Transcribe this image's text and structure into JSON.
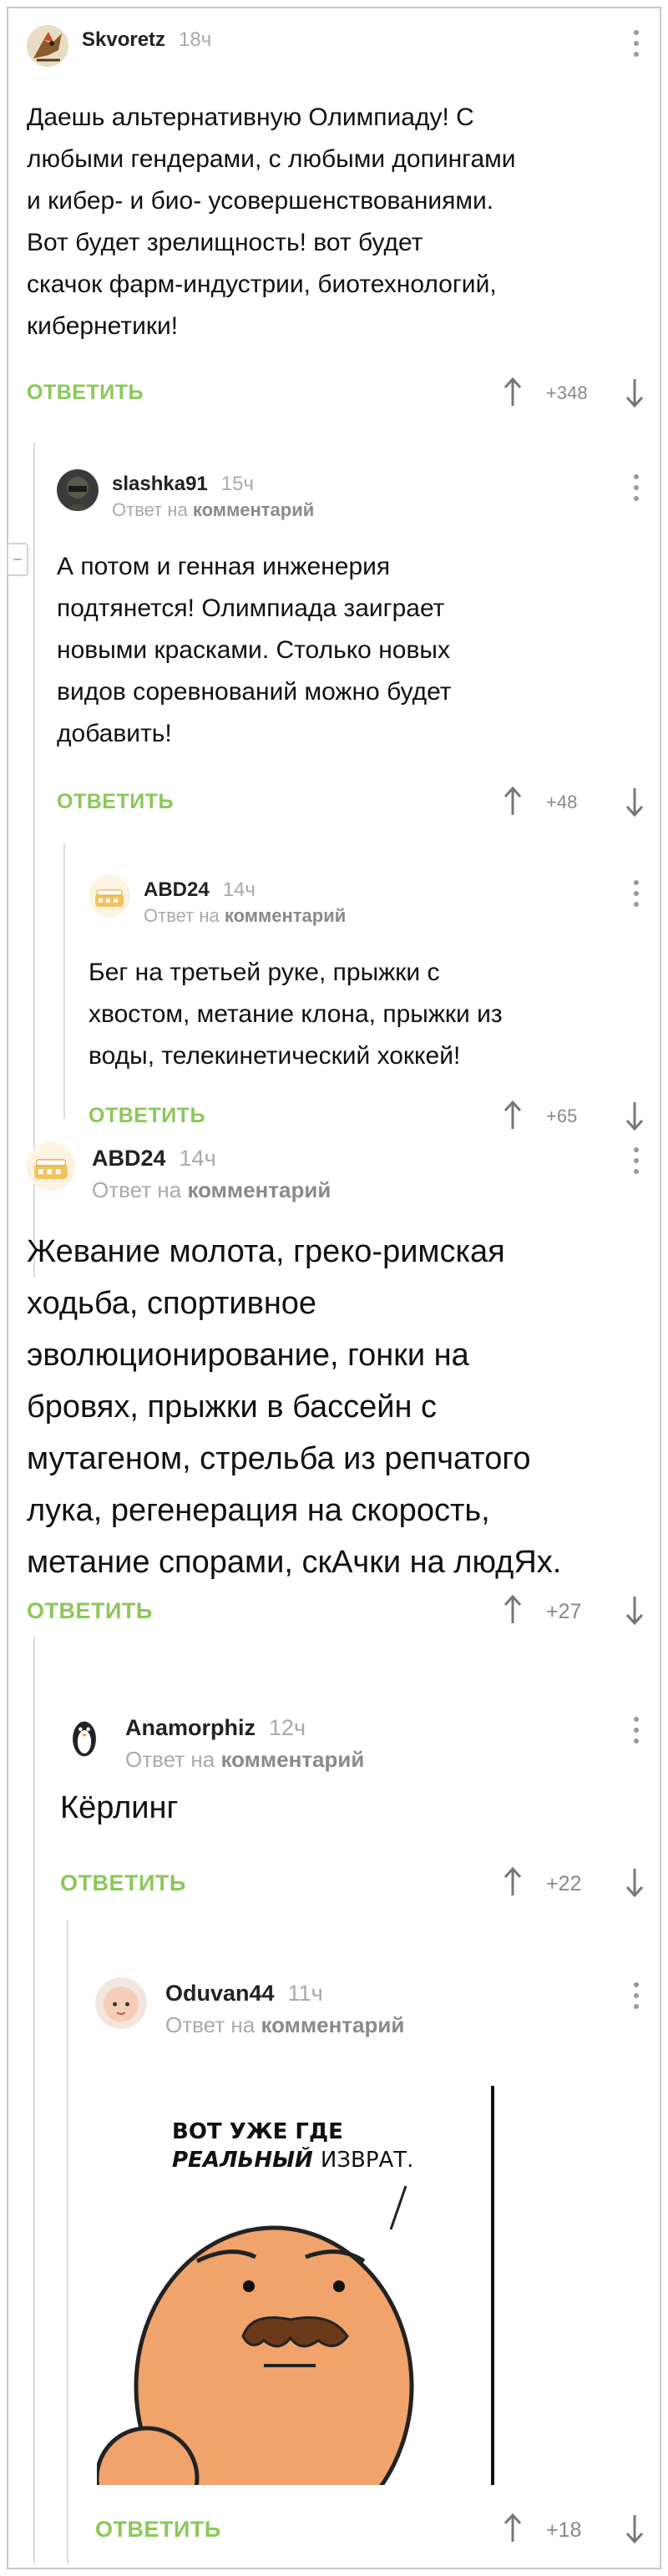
{
  "reply_label": "ОТВЕТИТЬ",
  "reply_to_prefix": "Ответ на",
  "reply_to_target": "комментарий",
  "colors": {
    "accent_green": "#8ac858",
    "muted_text": "#aaaaaa",
    "thread_line": "#dcdcdc"
  },
  "icons": {
    "upvote": "arrow-up-icon",
    "downvote": "arrow-down-icon",
    "menu": "more-vertical-icon"
  },
  "comments": [
    {
      "author": "Skvoretz",
      "time": "18ч",
      "text_lines": [
        "Даешь альтернативную Олимпиаду! С",
        "любыми гендерами, с любыми допингами",
        "и кибер- и био- усовершенствованиями.",
        "Вот будет зрелищность! вот будет",
        "скачок фарм-индустрии, биотехнологий,",
        "кибернетики!"
      ],
      "score": "+348"
    },
    {
      "author": "slashka91",
      "time": "15ч",
      "text_lines": [
        "А потом и генная инженерия",
        "подтянется! Олимпиада заиграет",
        "новыми красками. Столько новых",
        "видов соревнований можно будет",
        "добавить!"
      ],
      "score": "+48"
    },
    {
      "author": "ABD24",
      "time": "14ч",
      "text_lines": [
        "Бег на третьей руке, прыжки с",
        "хвостом, метание клона, прыжки из",
        "воды, телекинетический хоккей!"
      ],
      "score": "+65"
    },
    {
      "author": "ABD24",
      "time": "14ч",
      "text_lines": [
        "Жевание молота, греко-римская",
        "ходьба, спортивное",
        "эволюционирование, гонки на",
        "бровях, прыжки в бассейн с",
        "мутагеном, стрельба из репчатого",
        "лука, регенерация на скорость,",
        "метание спорами, скАчки на людЯх."
      ],
      "score": "+27"
    },
    {
      "author": "Anamorphiz",
      "time": "12ч",
      "text_lines": [
        "Кёрлинг"
      ],
      "score": "+22"
    },
    {
      "author": "Oduvan44",
      "time": "11ч",
      "text_lines": [],
      "meme_caption_line1": "ВОТ УЖЕ ГДЕ",
      "meme_caption_line2_em": "РЕАЛЬНЫЙ",
      "meme_caption_line2_rest": "ИЗВРАТ.",
      "score": "+18"
    }
  ]
}
